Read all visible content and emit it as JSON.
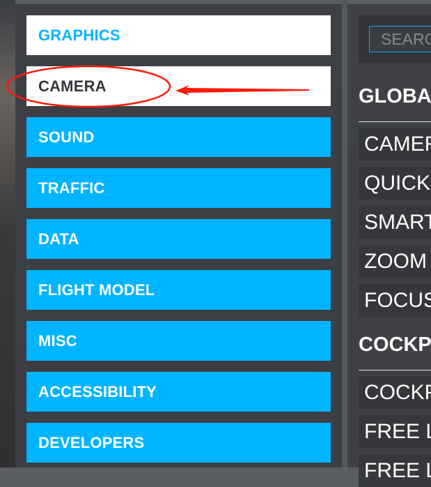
{
  "sidebar": {
    "items": [
      {
        "label": "GRAPHICS",
        "state": "active"
      },
      {
        "label": "CAMERA",
        "state": "hover"
      },
      {
        "label": "SOUND"
      },
      {
        "label": "TRAFFIC"
      },
      {
        "label": "DATA"
      },
      {
        "label": "FLIGHT MODEL"
      },
      {
        "label": "MISC"
      },
      {
        "label": "ACCESSIBILITY"
      },
      {
        "label": "DEVELOPERS"
      }
    ]
  },
  "search": {
    "placeholder": "SEARCH"
  },
  "content": {
    "sections": [
      {
        "title": "GLOBAL",
        "items": [
          "CAMERA",
          "QUICK",
          "SMART",
          "ZOOM",
          "FOCUS"
        ]
      },
      {
        "title": "COCKPIT",
        "items": [
          "COCKPIT",
          "FREE L",
          "FREE L"
        ]
      }
    ]
  },
  "colors": {
    "accent": "#00b4ff",
    "annotation": "#ff1a0a"
  }
}
